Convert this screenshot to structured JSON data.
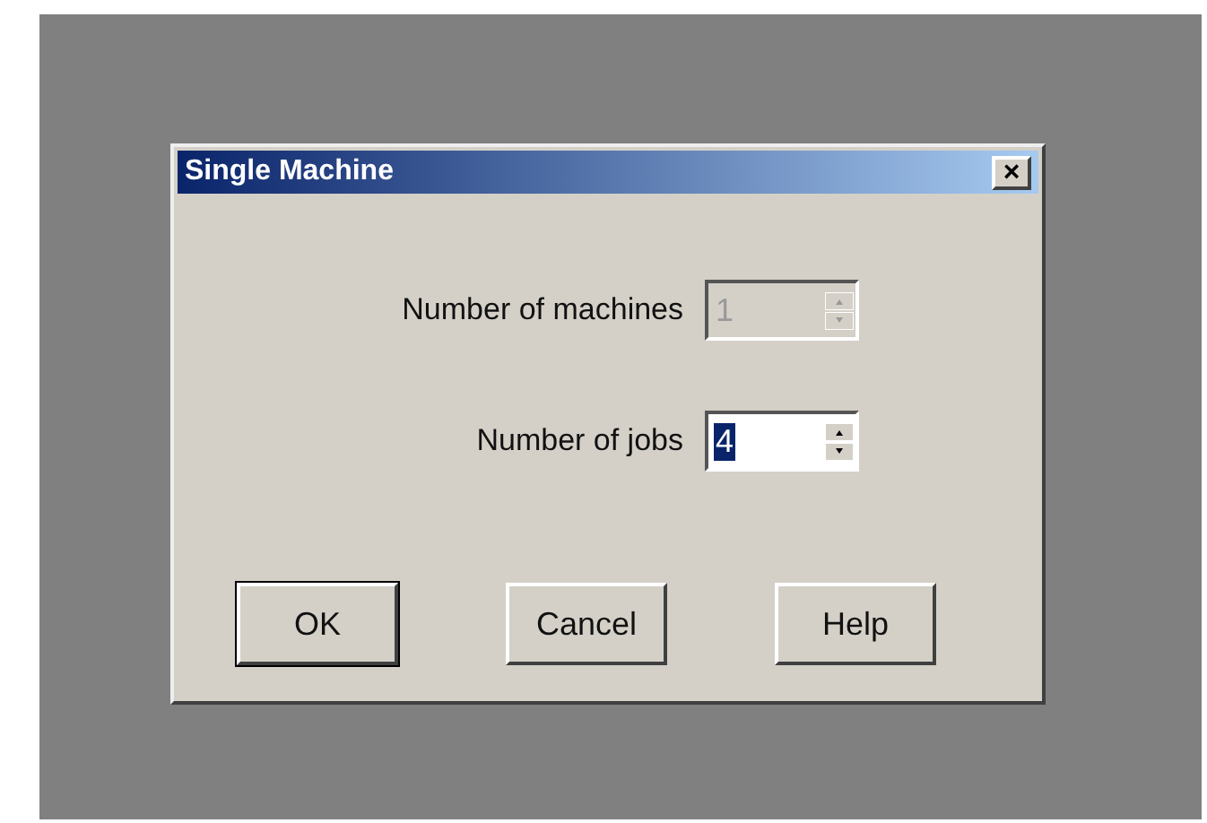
{
  "window": {
    "title": "Single Machine",
    "close": "×"
  },
  "fields": [
    {
      "label": "Number of machines",
      "value": "1",
      "disabled": true,
      "selected": false
    },
    {
      "label": "Number of jobs",
      "value": "4",
      "disabled": false,
      "selected": true
    }
  ],
  "buttons": [
    {
      "label": "OK",
      "default": true
    },
    {
      "label": "Cancel",
      "default": false
    },
    {
      "label": "Help",
      "default": false
    }
  ]
}
